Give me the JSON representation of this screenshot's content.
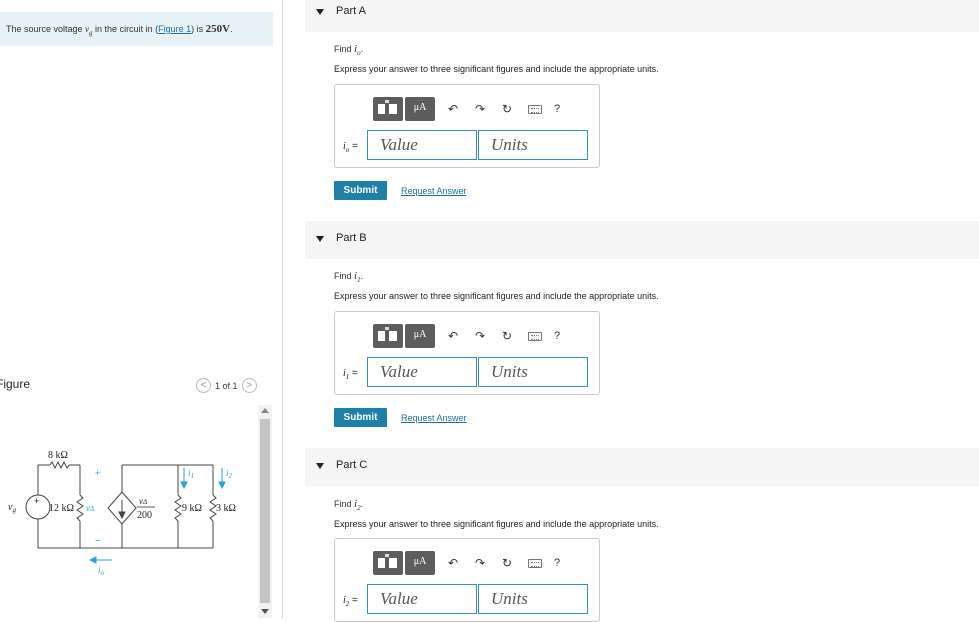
{
  "intro": {
    "prefix": "The source voltage ",
    "var": "v",
    "sub": "g",
    "middle": " in the circuit in (",
    "link": "Figure 1",
    "suffix": ") is ",
    "value": "250",
    "unit": "V",
    "end": "."
  },
  "figure": {
    "label": "Figure",
    "pager": "1 of 1",
    "prev": "<",
    "next": ">"
  },
  "circuit": {
    "r1": "8 kΩ",
    "r2": "12 kΩ",
    "vdelta": "v",
    "vdelta_sub": "Δ",
    "dep_num": "v",
    "dep_den": "200",
    "r3": "9 kΩ",
    "r4": "3 kΩ",
    "i1": "i",
    "i1_sub": "1",
    "i2": "i",
    "i2_sub": "2",
    "io": "i",
    "io_sub": "o",
    "vg": "v",
    "vg_sub": "g",
    "plus": "+",
    "minus": "−"
  },
  "toolbar": {
    "unit_btn": "μA",
    "undo": "↶",
    "redo": "↷",
    "reset": "↻",
    "help": "?"
  },
  "parts": [
    {
      "title": "Part A",
      "find_prefix": "Find ",
      "var": "i",
      "sub": "o",
      "find_suffix": ".",
      "express": "Express your answer to three significant figures and include the appropriate units.",
      "value_ph": "Value",
      "units_ph": "Units",
      "submit": "Submit",
      "request": "Request Answer"
    },
    {
      "title": "Part B",
      "find_prefix": "Find ",
      "var": "i",
      "sub": "1",
      "find_suffix": ".",
      "express": "Express your answer to three significant figures and include the appropriate units.",
      "value_ph": "Value",
      "units_ph": "Units",
      "submit": "Submit",
      "request": "Request Answer"
    },
    {
      "title": "Part C",
      "find_prefix": "Find ",
      "var": "i",
      "sub": "2",
      "find_suffix": ".",
      "express": "Express your answer to three significant figures and include the appropriate units.",
      "value_ph": "Value",
      "units_ph": "Units",
      "submit": "Submit",
      "request": "Request Answer"
    }
  ],
  "colors": {
    "accent": "#1e7fa8",
    "link": "#1b6fa8",
    "input_border": "#3a8fb7",
    "current_arrow": "#29a0d8"
  }
}
